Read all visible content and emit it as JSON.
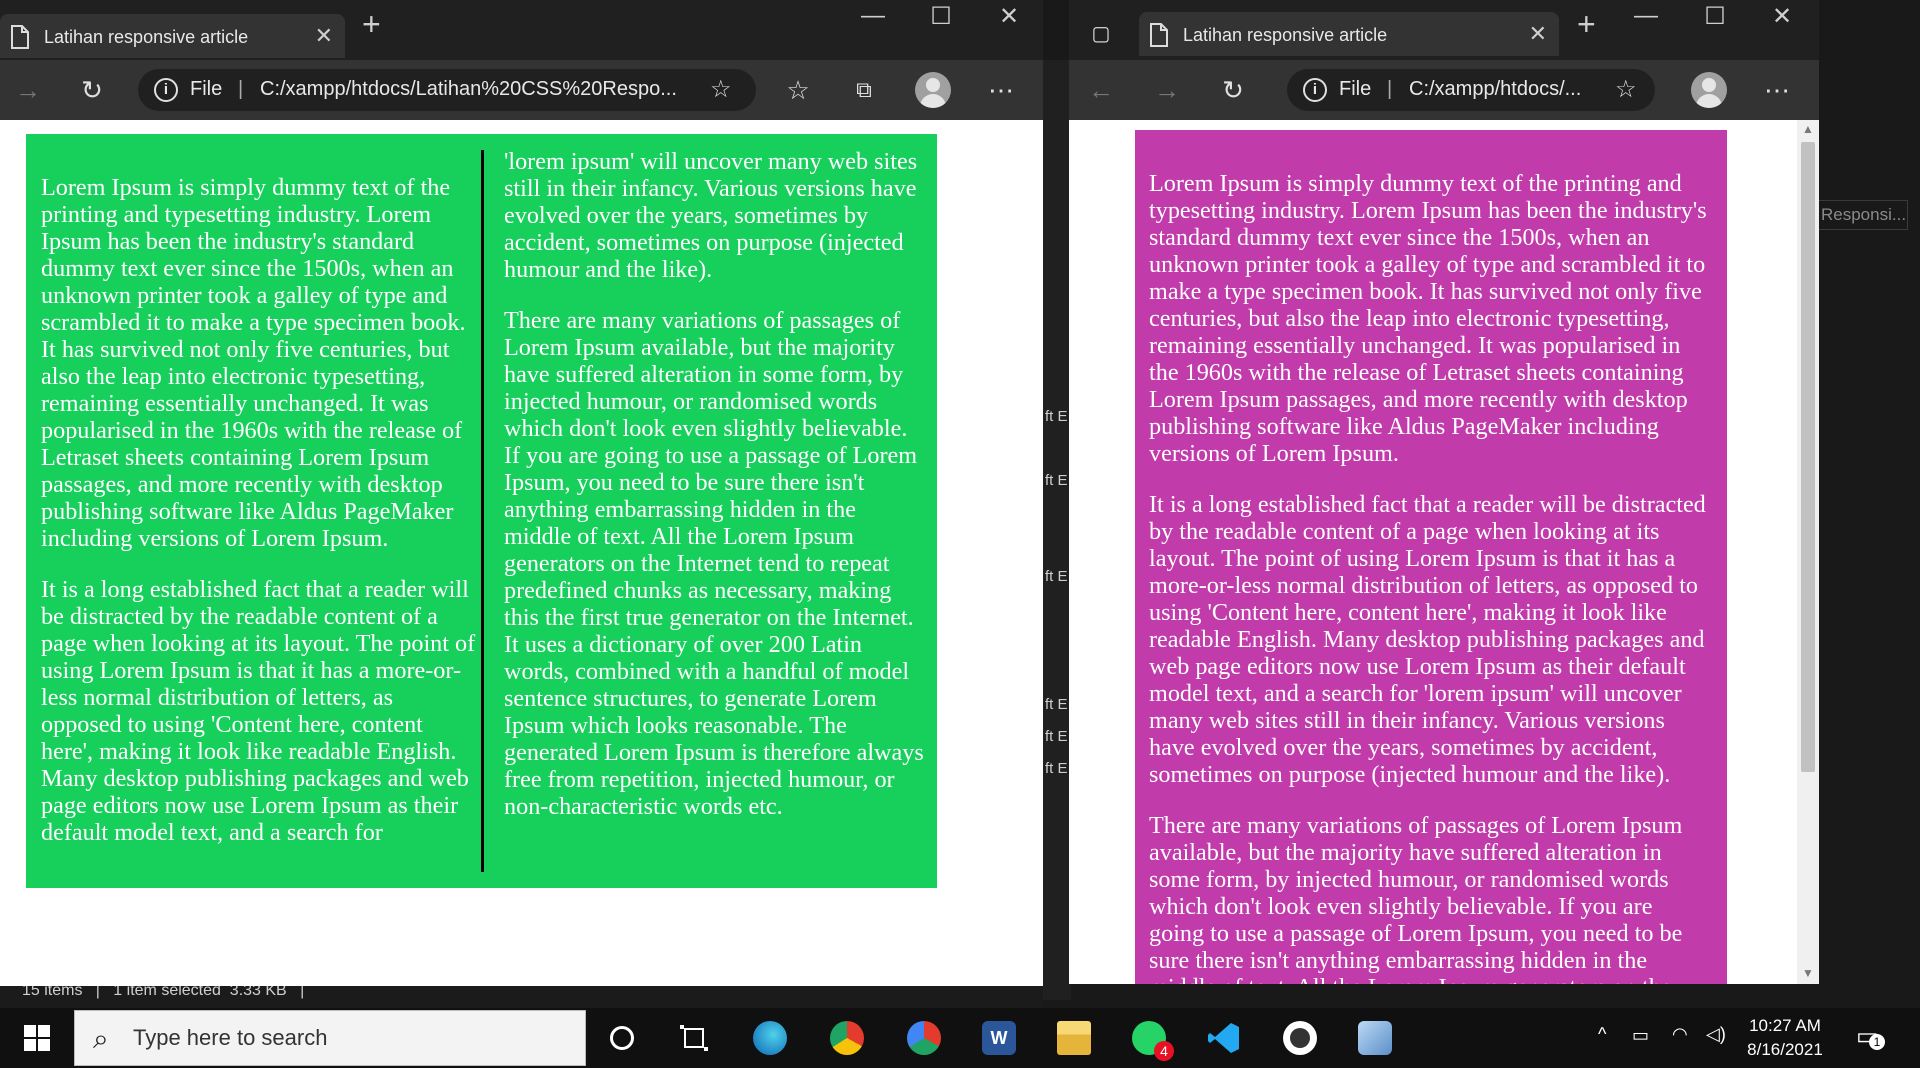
{
  "background": {
    "explorer_status": "15 items   |   1 item selected  3.33 KB   |",
    "side_labels": [
      "ft E",
      "ft E",
      "ft E",
      "ft E",
      "ft E",
      "ft E"
    ],
    "right_panel_label": "Responsi..."
  },
  "left_browser": {
    "tab_title": "Latihan responsive article",
    "address": {
      "scheme_label": "File",
      "url": "C:/xampp/htdocs/Latihan%20CSS%20Respo..."
    },
    "article_color": "#17d05c",
    "column1": [
      "Lorem Ipsum is simply dummy text of the printing and typesetting industry. Lorem Ipsum has been the industry's standard dummy text ever since the 1500s, when an unknown printer took a galley of type and scrambled it to make a type specimen book. It has survived not only five centuries, but also the leap into electronic typesetting, remaining essentially unchanged. It was popularised in the 1960s with the release of Letraset sheets containing Lorem Ipsum passages, and more recently with desktop publishing software like Aldus PageMaker including versions of Lorem Ipsum.",
      "It is a long established fact that a reader will be distracted by the readable content of a page when looking at its layout. The point of using Lorem Ipsum is that it has a more-or-less normal distribution of letters, as opposed to using 'Content here, content here', making it look like readable English. Many desktop publishing packages and web page editors now use Lorem Ipsum as their default model text, and a search for"
    ],
    "column2": [
      "'lorem ipsum' will uncover many web sites still in their infancy. Various versions have evolved over the years, sometimes by accident, sometimes on purpose (injected humour and the like).",
      "There are many variations of passages of Lorem Ipsum available, but the majority have suffered alteration in some form, by injected humour, or randomised words which don't look even slightly believable. If you are going to use a passage of Lorem Ipsum, you need to be sure there isn't anything embarrassing hidden in the middle of text. All the Lorem Ipsum generators on the Internet tend to repeat predefined chunks as necessary, making this the first true generator on the Internet. It uses a dictionary of over 200 Latin words, combined with a handful of model sentence structures, to generate Lorem Ipsum which looks reasonable. The generated Lorem Ipsum is therefore always free from repetition, injected humour, or non-characteristic words etc."
    ]
  },
  "right_browser": {
    "tab_title": "Latihan responsive article",
    "address": {
      "scheme_label": "File",
      "url": "C:/xampp/htdocs/..."
    },
    "article_color": "#c23bab",
    "paragraphs": [
      "Lorem Ipsum is simply dummy text of the printing and typesetting industry. Lorem Ipsum has been the industry's standard dummy text ever since the 1500s, when an unknown printer took a galley of type and scrambled it to make a type specimen book. It has survived not only five centuries, but also the leap into electronic typesetting, remaining essentially unchanged. It was popularised in the 1960s with the release of Letraset sheets containing Lorem Ipsum passages, and more recently with desktop publishing software like Aldus PageMaker including versions of Lorem Ipsum.",
      "It is a long established fact that a reader will be distracted by the readable content of a page when looking at its layout. The point of using Lorem Ipsum is that it has a more-or-less normal distribution of letters, as opposed to using 'Content here, content here', making it look like readable English. Many desktop publishing packages and web page editors now use Lorem Ipsum as their default model text, and a search for 'lorem ipsum' will uncover many web sites still in their infancy. Various versions have evolved over the years, sometimes by accident, sometimes on purpose (injected humour and the like).",
      "There are many variations of passages of Lorem Ipsum available, but the majority have suffered alteration in some form, by injected humour, or randomised words which don't look even slightly believable. If you are going to use a passage of Lorem Ipsum, you need to be sure there isn't anything embarrassing hidden in the middle of text. All the Lorem Ipsum generators on the Internet tend to repeat predefined chunks as necessary, making this the first true generator on the Internet."
    ]
  },
  "taskbar": {
    "search_placeholder": "Type here to search",
    "whatsapp_badge": "4",
    "time": "10:27 AM",
    "date": "8/16/2021",
    "notification_count": "1",
    "apps": [
      "edge-icon",
      "chrome-icon",
      "chrome-alt-icon",
      "word-icon",
      "file-explorer-icon",
      "whatsapp-icon",
      "vscode-icon",
      "obs-icon",
      "virtualbox-icon"
    ]
  }
}
